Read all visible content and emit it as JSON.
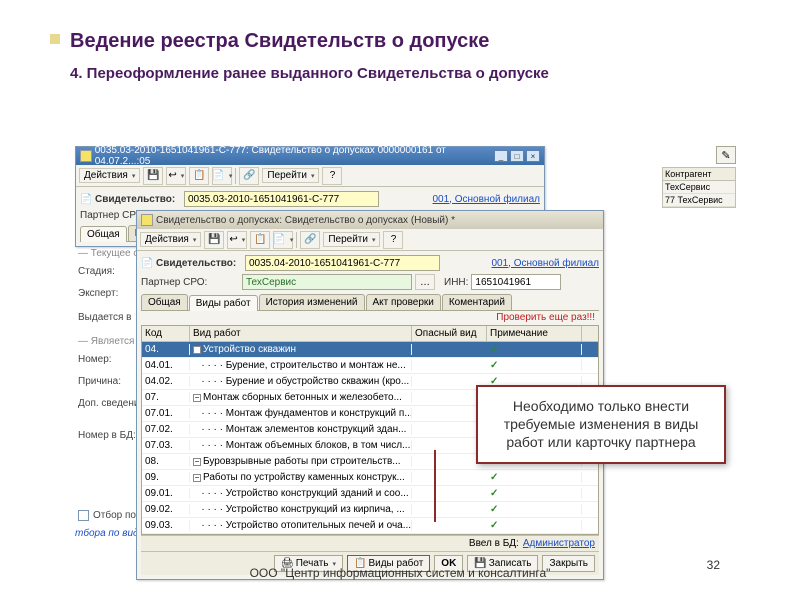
{
  "slide": {
    "title": "Ведение реестра Свидетельств о допуске",
    "subtitle": "4. Переоформление ранее выданного Свидетельства о допуске",
    "footer_org": "ООО \"Центр информационных систем и консалтинга\"",
    "page_number": "32",
    "callout_text": "Необходимо только внести требуемые изменения в виды работ или карточку партнера"
  },
  "win1": {
    "title": "0035.03-2010-1651041961-С-777: Свидетельство о допусках 0000000161 от 04.07.2...:05",
    "actions_label": "Действия",
    "goto_label": "Перейти",
    "cert_label": "Свидетельство:",
    "cert_value": "0035.03-2010-1651041961-С-777",
    "branch_link": "001, Основной филиал",
    "partner_label": "Партнер СРО:",
    "tabs": [
      "Общая",
      "Виды"
    ],
    "side": {
      "current_group": "Текущее с",
      "stage": "Стадия:",
      "expert": "Эксперт:",
      "issued": "Выдается в",
      "prev_group": "Является п",
      "number": "Номер:",
      "reason": "Причина:",
      "extra": "Доп. сведения:",
      "db_num": "Номер в БД:"
    },
    "filter_label": "Отбор по видам",
    "back_label": "тбора по видам ра"
  },
  "win2": {
    "title": "Свидетельство о допусках: Свидетельство о допусках (Новый) *",
    "actions_label": "Действия",
    "goto_label": "Перейти",
    "cert_label": "Свидетельство:",
    "cert_value": "0035.04-2010-1651041961-С-777",
    "branch_link": "001, Основной филиал",
    "partner_label": "Партнер СРО:",
    "partner_value": "ТехСервис",
    "inn_label": "ИНН:",
    "inn_value": "1651041961",
    "tabs": [
      "Общая",
      "Виды работ",
      "История изменений",
      "Акт проверки",
      "Коментарий"
    ],
    "active_tab": 1,
    "recheck_link": "Проверить еще раз!!!",
    "grid": {
      "headers": [
        "Код",
        "Вид работ",
        "Опасный вид",
        "Примечание"
      ],
      "rows": [
        {
          "code": "04.",
          "name": "Устройство скважин",
          "exp": true,
          "check": true
        },
        {
          "code": "04.01.",
          "name": "Бурение, строительство и монтаж не...",
          "indent": 2,
          "check": true
        },
        {
          "code": "04.02.",
          "name": "Бурение и обустройство скважин (кро...",
          "indent": 2,
          "check": true
        },
        {
          "code": "07.",
          "name": "Монтаж сборных бетонных и железобето...",
          "exp": true,
          "check": true
        },
        {
          "code": "07.01.",
          "name": "Монтаж фундаментов и конструкций п...",
          "indent": 2,
          "check": true
        },
        {
          "code": "07.02.",
          "name": "Монтаж элементов конструкций здан...",
          "indent": 2,
          "check": true
        },
        {
          "code": "07.03.",
          "name": "Монтаж объемных блоков, в том числ...",
          "indent": 2,
          "check": true
        },
        {
          "code": "08.",
          "name": "Буровзрывные работы при строительств...",
          "check": true
        },
        {
          "code": "09.",
          "name": "Работы по устройству каменных конструк...",
          "exp": true,
          "check": true
        },
        {
          "code": "09.01.",
          "name": "Устройство конструкций зданий и соо...",
          "indent": 2,
          "check": true
        },
        {
          "code": "09.02.",
          "name": "Устройство конструкций из кирпича, ...",
          "indent": 2,
          "check": true
        },
        {
          "code": "09.03.",
          "name": "Устройство отопительных печей и оча...",
          "indent": 2,
          "check": true
        }
      ]
    },
    "status": {
      "db_label": "Ввел в БД:",
      "db_user": "Администратор"
    },
    "buttons": {
      "print": "Печать",
      "types": "Виды работ",
      "ok": "OK",
      "save": "Записать",
      "close": "Закрыть"
    }
  },
  "right_panel": {
    "header": "Контрагент",
    "rows": [
      "ТехСервис",
      "ТехСервис"
    ],
    "code": "77"
  }
}
